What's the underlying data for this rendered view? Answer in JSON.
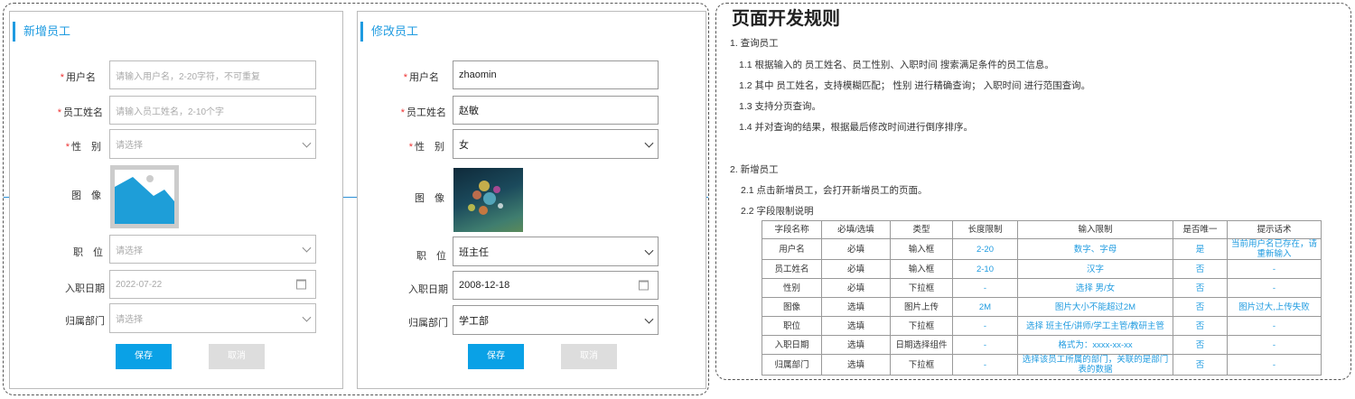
{
  "add_panel": {
    "title": "新增员工",
    "labels": {
      "username": "用户名",
      "name": "员工姓名",
      "gender": "性　别",
      "image": "图　像",
      "position": "职　位",
      "entry_date": "入职日期",
      "dept": "归属部门"
    },
    "required_mark": "*",
    "username_placeholder": "请输入用户名，2-20字符，不可重复",
    "name_placeholder": "请输入员工姓名，2-10个字",
    "gender_placeholder": "请选择",
    "position_placeholder": "请选择",
    "entry_date_value": "2022-07-22",
    "dept_placeholder": "请选择",
    "save": "保存",
    "cancel": "取消"
  },
  "edit_panel": {
    "title": "修改员工",
    "labels": {
      "username": "用户名",
      "name": "员工姓名",
      "gender": "性　别",
      "image": "图　像",
      "position": "职　位",
      "entry_date": "入职日期",
      "dept": "归属部门"
    },
    "required_mark": "*",
    "username_value": "zhaomin",
    "name_value": "赵敏",
    "gender_value": "女",
    "position_value": "班主任",
    "entry_date_value": "2008-12-18",
    "dept_value": "学工部",
    "save": "保存",
    "cancel": "取消"
  },
  "rules": {
    "title": "页面开发规则",
    "lines": [
      "1. 查询员工",
      "1.1 根据输入的 员工姓名、员工性别、入职时间 搜索满足条件的员工信息。",
      "1.2 其中 员工姓名，支持模糊匹配； 性别 进行精确查询； 入职时间 进行范围查询。",
      "1.3 支持分页查询。",
      "1.4 并对查询的结果，根据最后修改时间进行倒序排序。",
      "2. 新增员工",
      "2.1 点击新增员工，会打开新增员工的页面。",
      "2.2 字段限制说明"
    ],
    "table_headers": [
      "字段名称",
      "必填/选填",
      "类型",
      "长度限制",
      "输入限制",
      "是否唯一",
      "提示话术"
    ],
    "table_rows": [
      [
        "用户名",
        "必填",
        "输入框",
        "2-20",
        "数字、字母",
        "是",
        "当前用户名已存在，请重新输入"
      ],
      [
        "员工姓名",
        "必填",
        "输入框",
        "2-10",
        "汉字",
        "否",
        "-"
      ],
      [
        "性别",
        "必填",
        "下拉框",
        "-",
        "选择 男/女",
        "否",
        "-"
      ],
      [
        "图像",
        "选填",
        "图片上传",
        "2M",
        "图片大小不能超过2M",
        "否",
        "图片过大,上传失败"
      ],
      [
        "职位",
        "选填",
        "下拉框",
        "-",
        "选择 班主任/讲师/学工主管/教研主管",
        "否",
        "-"
      ],
      [
        "入职日期",
        "选填",
        "日期选择组件",
        "-",
        "格式为：xxxx-xx-xx",
        "否",
        "-"
      ],
      [
        "归属部门",
        "选填",
        "下拉框",
        "-",
        "选择该员工所属的部门，关联的是部门表的数据",
        "否",
        "-"
      ]
    ]
  }
}
